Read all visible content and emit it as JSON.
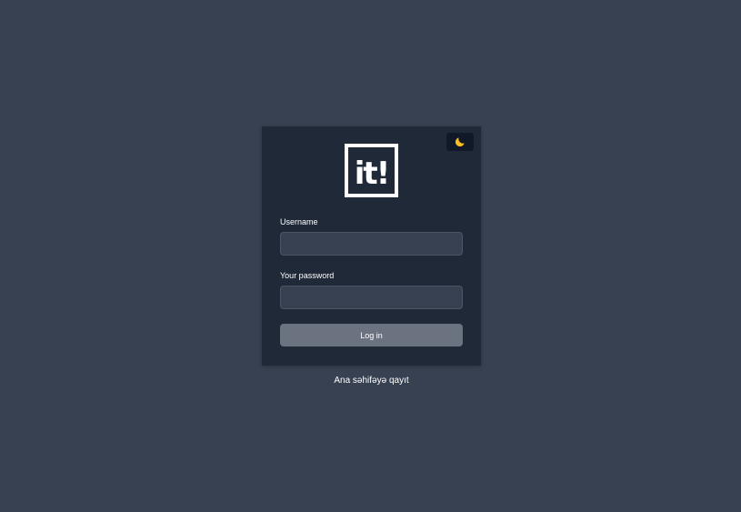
{
  "theme_toggle": {
    "icon": "moon-icon",
    "color": "#fbbf24"
  },
  "logo": {
    "text": "it!"
  },
  "form": {
    "username_label": "Username",
    "username_value": "",
    "password_label": "Your password",
    "password_value": "",
    "submit_label": "Log in"
  },
  "footer": {
    "back_link": "Ana səhifəyə qayıt"
  },
  "colors": {
    "page_bg": "#374151",
    "card_bg": "#1f2937",
    "input_bg": "#374151",
    "button_bg": "#6b7280",
    "accent": "#fbbf24"
  }
}
